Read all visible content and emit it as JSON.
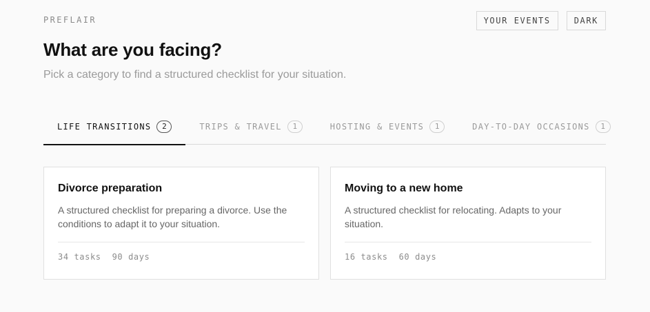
{
  "header": {
    "brand": "PREFLAIR",
    "your_events_label": "YOUR EVENTS",
    "theme_toggle_label": "DARK"
  },
  "main": {
    "title": "What are you facing?",
    "subtitle": "Pick a category to find a structured checklist for your situation."
  },
  "tabs": [
    {
      "label": "LIFE TRANSITIONS",
      "count": "2",
      "active": true
    },
    {
      "label": "TRIPS & TRAVEL",
      "count": "1",
      "active": false
    },
    {
      "label": "HOSTING & EVENTS",
      "count": "1",
      "active": false
    },
    {
      "label": "DAY-TO-DAY OCCASIONS",
      "count": "1",
      "active": false
    }
  ],
  "cards": [
    {
      "title": "Divorce preparation",
      "description": "A structured checklist for preparing a divorce. Use the conditions to adapt it to your situation.",
      "tasks": "34 tasks",
      "days": "90 days"
    },
    {
      "title": "Moving to a new home",
      "description": "A structured checklist for relocating. Adapts to your situation.",
      "tasks": "16 tasks",
      "days": "60 days"
    }
  ]
}
